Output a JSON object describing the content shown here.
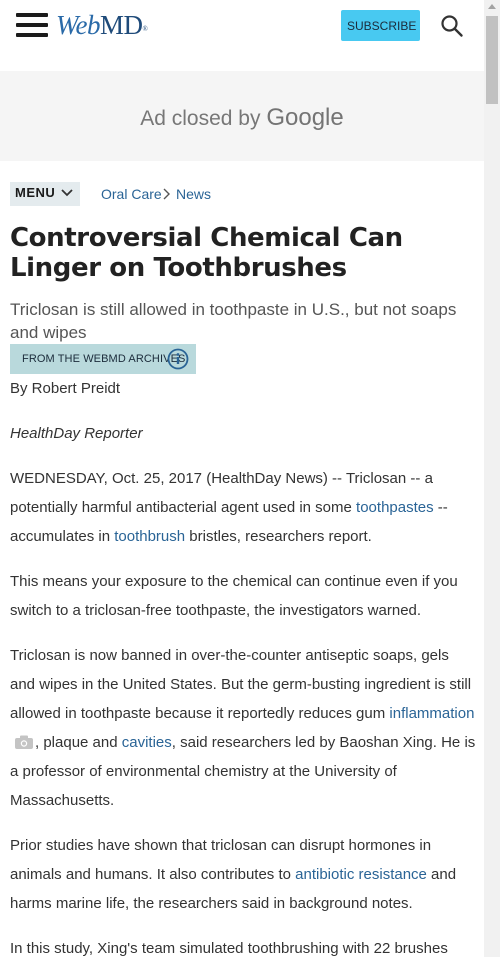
{
  "header": {
    "logo_web": "Web",
    "logo_md": "MD",
    "logo_mark": "®",
    "subscribe_label": "SUBSCRIBE",
    "icons": [
      "hamburger-menu-icon",
      "search-icon"
    ]
  },
  "ad": {
    "text": "Ad closed by",
    "brand": "Google"
  },
  "breadcrumb": {
    "menu_label": "MENU",
    "items": [
      "Oral Care",
      "News"
    ]
  },
  "article": {
    "title": "Controversial Chemical Can Linger on Toothbrushes",
    "subtitle": "Triclosan is still allowed in toothpaste in U.S., but not soaps and wipes",
    "archives_label": "FROM THE WEBMD ARCHIVES",
    "byline": "By Robert Preidt",
    "reporter": "HealthDay Reporter",
    "p1": {
      "a": "WEDNESDAY, Oct. 25, 2017 (HealthDay News) -- Triclosan -- a potentially harmful antibacterial agent used in some ",
      "link1": "toothpastes",
      "b": " -- accumulates in ",
      "link2": "toothbrush",
      "c": " bristles, researchers report."
    },
    "p2": "This means your exposure to the chemical can continue even if you switch to a triclosan-free toothpaste, the investigators warned.",
    "p3": {
      "a": "Triclosan is now banned in over-the-counter antiseptic soaps, gels and wipes in the United States. But the germ-busting ingredient is still allowed in toothpaste because it reportedly reduces gum ",
      "link1": "inflammation",
      "b": ", plaque and ",
      "link2": "cavities",
      "c": ", said researchers led by Baoshan Xing. He is a professor of environmental chemistry at the University of Massachusetts."
    },
    "p4": {
      "a": "Prior studies have shown that triclosan can disrupt hormones in animals and humans. It also contributes to ",
      "link1": "antibiotic resistance",
      "b": " and harms marine life, the researchers said in background notes."
    },
    "p5": "In this study, Xing's team simulated toothbrushing with 22 brushes"
  },
  "colors": {
    "link": "#2a6496",
    "subscribe_bg": "#48c9f1",
    "archives_bg": "#b9d9dc",
    "logo": "#2a6aa8"
  }
}
